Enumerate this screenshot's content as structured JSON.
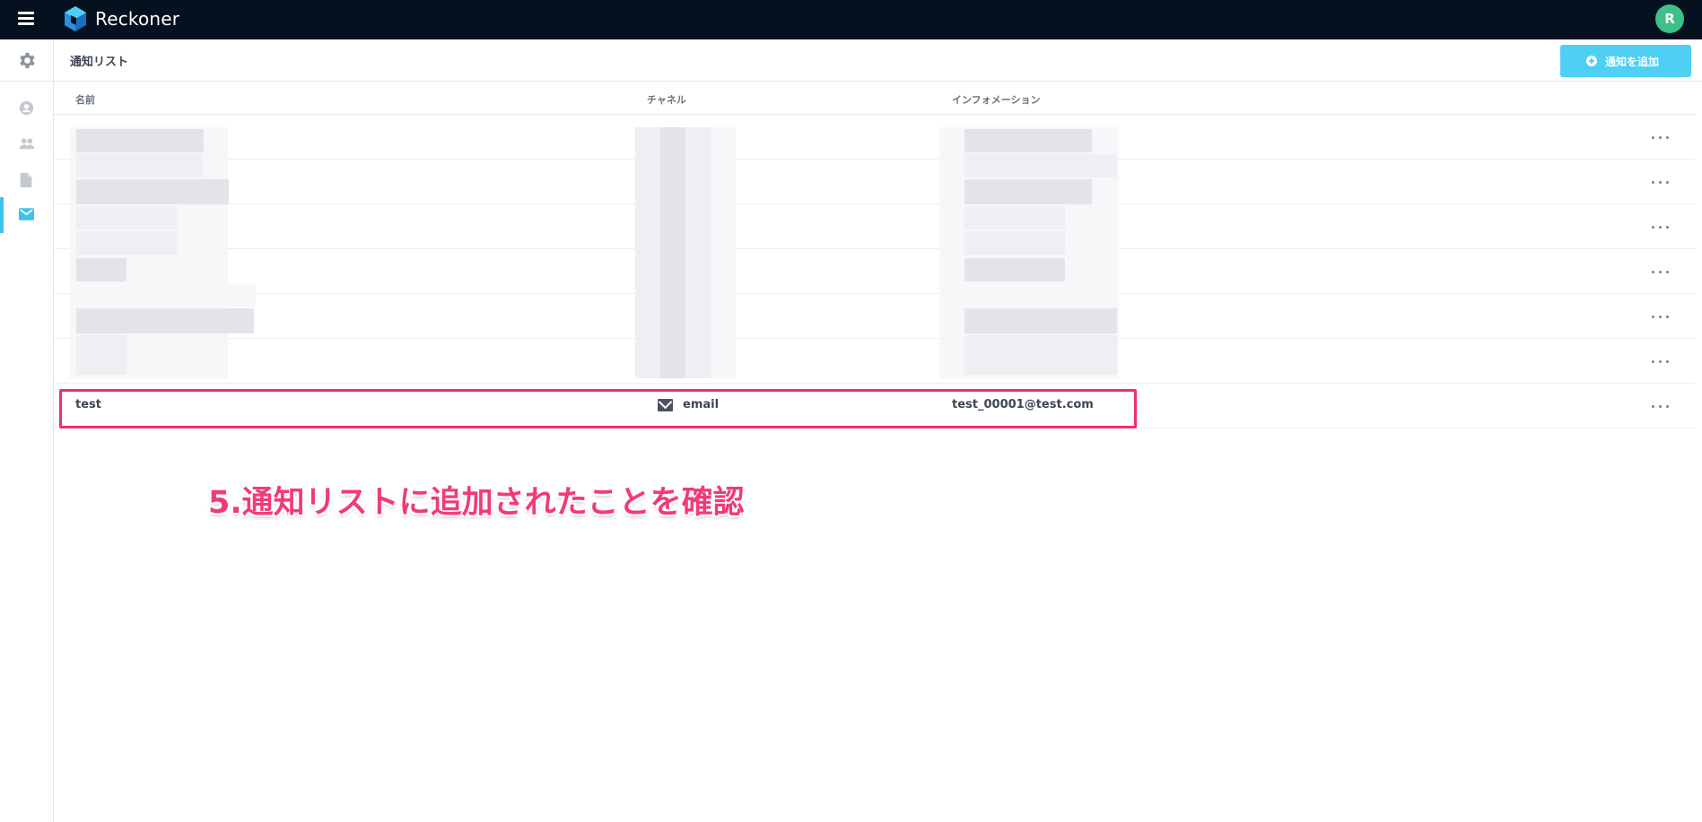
{
  "app": {
    "title": "Reckoner",
    "user_initial": "R",
    "brand_color": "#3ec2e8"
  },
  "sidebar": {
    "items": [
      {
        "name": "settings",
        "icon": "gear-icon"
      },
      {
        "name": "users",
        "icon": "user-icon"
      },
      {
        "name": "groups",
        "icon": "group-icon"
      },
      {
        "name": "documents",
        "icon": "document-icon"
      },
      {
        "name": "notifications",
        "icon": "mail-icon",
        "active": true
      }
    ]
  },
  "page": {
    "title": "通知リスト",
    "add_button_label": "通知を追加"
  },
  "table": {
    "headers": {
      "name": "名前",
      "channel": "チャネル",
      "information": "インフォメーション"
    },
    "new_row": {
      "name": "test",
      "channel": "email",
      "information": "test_00001@test.com"
    }
  },
  "annotation": "5.通知リストに追加されたことを確認"
}
